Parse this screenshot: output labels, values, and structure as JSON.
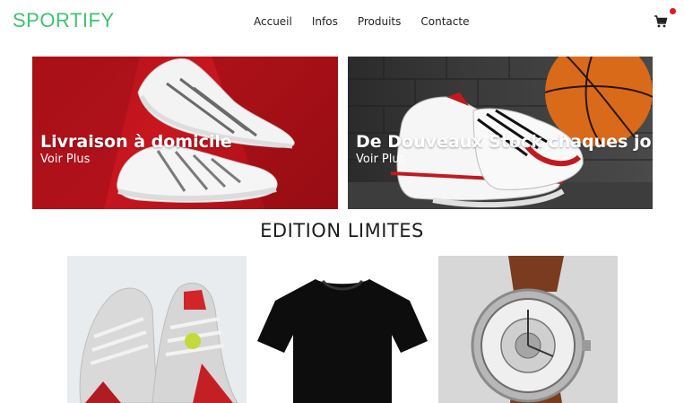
{
  "header": {
    "logo": "SPORTIFY",
    "nav": [
      "Accueil",
      "Infos",
      "Produits",
      "Contacte"
    ],
    "cart_icon": "cart-icon",
    "badge_color": "#e01b1b",
    "brand_color": "#3ec46d"
  },
  "banners": [
    {
      "title": "Livraison à domicile",
      "link": "Voir Plus"
    },
    {
      "title": "De Douveaux Stock chaques jours",
      "link": "Voir Plus"
    }
  ],
  "section": {
    "title": "EDITION LIMITES"
  },
  "products": [
    {
      "name": "sneaker"
    },
    {
      "name": "t-shirt"
    },
    {
      "name": "watch"
    }
  ]
}
